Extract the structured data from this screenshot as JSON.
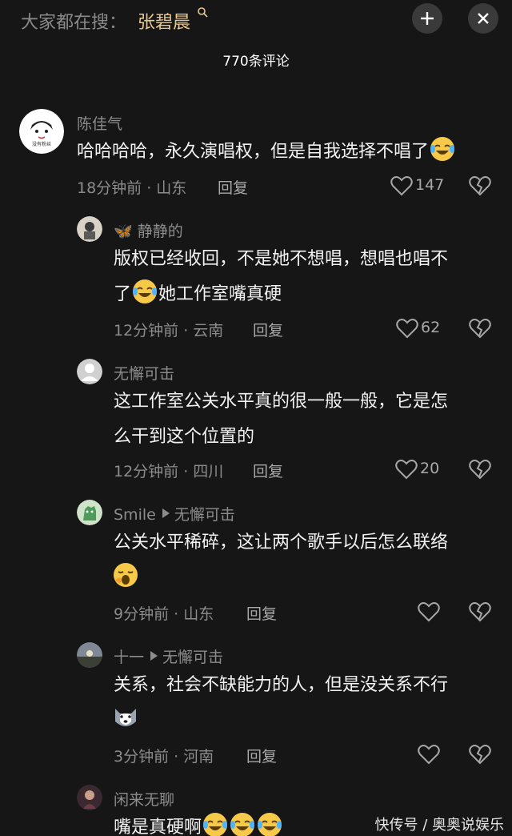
{
  "search": {
    "prefix": "大家都在搜：",
    "term": "张碧晨"
  },
  "header": {
    "comments_count": "770条评论"
  },
  "comments": [
    {
      "author": "陈佳气",
      "text": "哈哈哈哈，永久演唱权，但是自我选择不唱了",
      "time": "18分钟前 · 山东",
      "reply": "回复",
      "likes": "147"
    },
    {
      "author": "静静的",
      "text_line1": "版权已经收回，不是她不想唱，想唱也唱不",
      "text_line2": "她工作室嘴真硬",
      "text_line2_prefix": "了",
      "time": "12分钟前 · 云南",
      "reply": "回复",
      "likes": "62"
    },
    {
      "author": "无懈可击",
      "text_line1": "这工作室公关水平真的很一般一般，它是怎",
      "text_line2": "么干到这个位置的",
      "time": "12分钟前 · 四川",
      "reply": "回复",
      "likes": "20"
    },
    {
      "author": "Smile",
      "reply_to": "无懈可击",
      "text_line1": "公关水平稀碎，这让两个歌手以后怎么联络",
      "time": "9分钟前 · 山东",
      "reply": "回复",
      "likes": ""
    },
    {
      "author": "十一",
      "reply_to": "无懈可击",
      "text_line1": "关系，社会不缺能力的人，但是没关系不行",
      "time": "3分钟前 · 河南",
      "reply": "回复",
      "likes": ""
    },
    {
      "author": "闲来无聊",
      "text_line1": "嘴是真硬啊"
    }
  ],
  "watermark": "快传号 / 奥奥说娱乐",
  "colors": {
    "background": "#161616",
    "search_term": "#e8c98e",
    "muted": "#8c8c8c"
  }
}
